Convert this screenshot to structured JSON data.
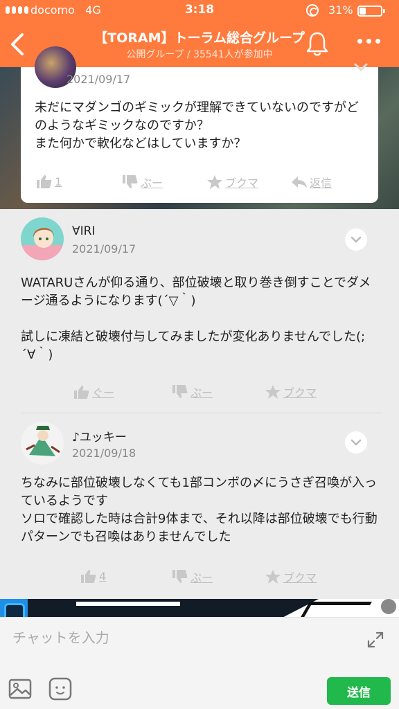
{
  "status_bar": {
    "carrier": "docomo",
    "network": "4G",
    "time": "3:18",
    "battery_percent": "31%",
    "battery_level": 0.31
  },
  "header": {
    "back_icon": "chevron-left-icon",
    "title": "【TORAM】トーラム総合グループ",
    "subtitle": "公開グループ / 35541人が参加中",
    "bell_icon": "bell-icon",
    "more_icon": "more-dots-icon"
  },
  "post": {
    "date": "2021/09/17",
    "text": "未だにマダンゴのギミックが理解できていないのですがどのようなギミックなのですか？\nまた何かで軟化などはしていますか？",
    "actions": {
      "like_label": "1",
      "dislike_label": "ぶー",
      "bookmark_label": "ブクマ",
      "reply_label": "返信"
    }
  },
  "comments": [
    {
      "name": "∀IRI",
      "date": "2021/09/17",
      "text": "WATARUさんが仰る通り、部位破壊と取り巻き倒すことでダメージ通るようになります(´▽｀)\n\n試しに凍結と破壊付与してみましたが変化ありませんでした(;´∀｀)",
      "like_label": "ぐー",
      "dislike_label": "ぶー",
      "bookmark_label": "ブクマ"
    },
    {
      "name": "♪ユッキー",
      "date": "2021/09/18",
      "text": "ちなみに部位破壊しなくても1部コンボの〆にうさぎ召喚が入っているようです\nソロで確認した時は合計9体まで、それ以降は部位破壊でも行動パターンでも召喚はありませんでした",
      "like_label": "4",
      "dislike_label": "ぶー",
      "bookmark_label": "ブクマ"
    }
  ],
  "composer": {
    "placeholder": "チャットを入力",
    "send_label": "送信"
  },
  "colors": {
    "header": "#ff7a3d",
    "send": "#21b84c",
    "background": "#ececec"
  }
}
